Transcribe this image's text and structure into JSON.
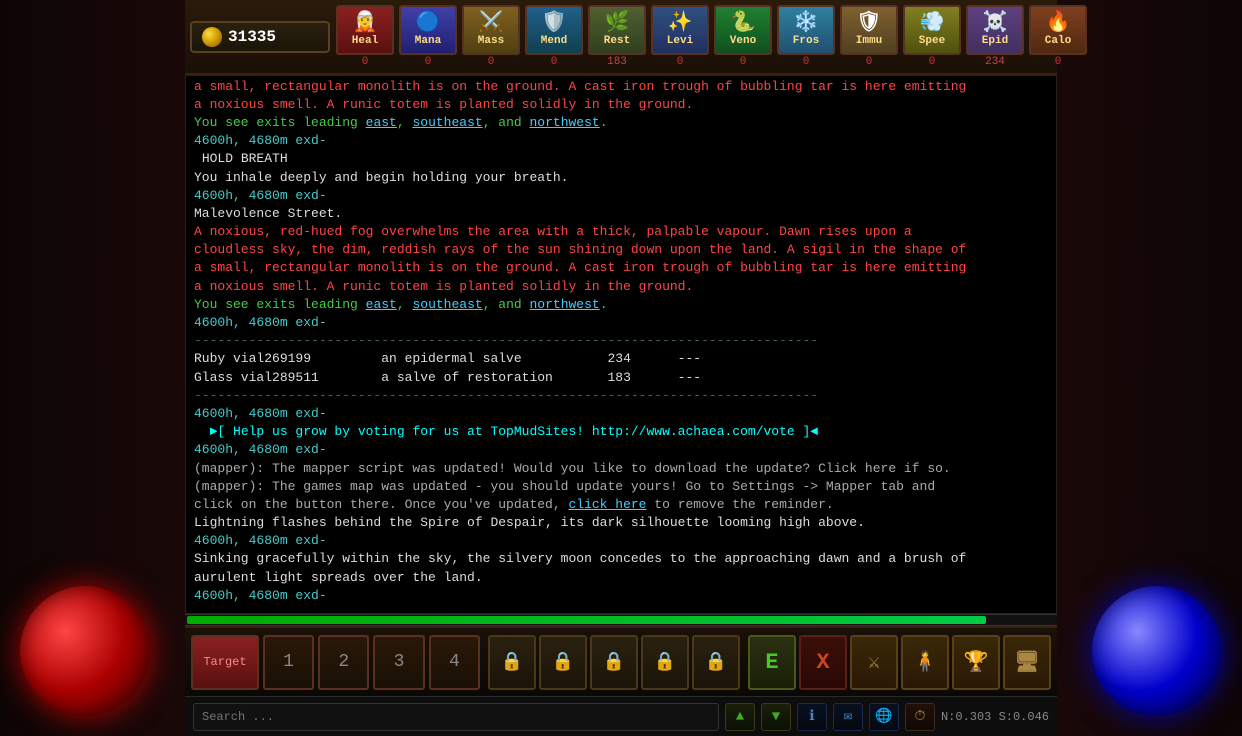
{
  "gold": {
    "amount": "31335",
    "icon": "💰"
  },
  "skills": [
    {
      "id": "heal",
      "label": "Heal",
      "count": "0",
      "css": "heal",
      "figure": "🧝"
    },
    {
      "id": "mana",
      "label": "Mana",
      "count": "0",
      "css": "mana",
      "figure": "🔵"
    },
    {
      "id": "mass",
      "label": "Mass",
      "count": "0",
      "css": "mass",
      "figure": "⚔️"
    },
    {
      "id": "mend",
      "label": "Mend",
      "count": "0",
      "css": "mend",
      "figure": "🛡️"
    },
    {
      "id": "rest",
      "label": "Rest",
      "count": "183",
      "css": "rest",
      "figure": "🌿"
    },
    {
      "id": "levi",
      "label": "Levi",
      "count": "0",
      "css": "levi",
      "figure": "✨"
    },
    {
      "id": "veno",
      "label": "Veno",
      "count": "0",
      "css": "veno",
      "figure": "🐍"
    },
    {
      "id": "fros",
      "label": "Fros",
      "count": "0",
      "css": "fros",
      "figure": "❄️"
    },
    {
      "id": "immu",
      "label": "Immu",
      "count": "0",
      "css": "immu",
      "figure": "🛡"
    },
    {
      "id": "spee",
      "label": "Spee",
      "count": "0",
      "css": "spee",
      "figure": "💨"
    },
    {
      "id": "epid",
      "label": "Epid",
      "count": "234",
      "css": "epid",
      "figure": "☠️"
    },
    {
      "id": "calo",
      "label": "Calo",
      "count": "0",
      "css": "calo",
      "figure": "🔥"
    }
  ],
  "terminal": {
    "lines": [
      {
        "text": "Malevolence Street.",
        "style": "white"
      },
      {
        "text": "A noxious, red-hued fog overwhelms the area with a thick, palpable vapour. Dawn rises upon a",
        "style": "red"
      },
      {
        "text": "cloudless sky, the dim, reddish rays of the sun shining down upon the land. A sigil in the shape of",
        "style": "red"
      },
      {
        "text": "a small, rectangular monolith is on the ground. A cast iron trough of bubbling tar is here emitting",
        "style": "red"
      },
      {
        "text": "a noxious smell. A runic totem is planted solidly in the ground.",
        "style": "red"
      },
      {
        "text": "You see exits leading east, southeast, and northwest.",
        "style": "green",
        "links": [
          "east",
          "southeast",
          "northwest"
        ]
      },
      {
        "text": "4600h, 4680m exd-",
        "style": "cyan"
      },
      {
        "text": " HOLD BREATH",
        "style": "white"
      },
      {
        "text": "You inhale deeply and begin holding your breath.",
        "style": "white"
      },
      {
        "text": "4600h, 4680m exd-",
        "style": "cyan"
      },
      {
        "text": "Malevolence Street.",
        "style": "white"
      },
      {
        "text": "A noxious, red-hued fog overwhelms the area with a thick, palpable vapour. Dawn rises upon a",
        "style": "red"
      },
      {
        "text": "cloudless sky, the dim, reddish rays of the sun shining down upon the land. A sigil in the shape of",
        "style": "red"
      },
      {
        "text": "a small, rectangular monolith is on the ground. A cast iron trough of bubbling tar is here emitting",
        "style": "red"
      },
      {
        "text": "a noxious smell. A runic totem is planted solidly in the ground.",
        "style": "red"
      },
      {
        "text": "You see exits leading east, southeast, and northwest.",
        "style": "green",
        "links": [
          "east",
          "southeast",
          "northwest"
        ]
      },
      {
        "text": "4600h, 4680m exd-",
        "style": "cyan"
      },
      {
        "text": "--------------------------------------------------------------------------------",
        "style": "divider"
      },
      {
        "text": "Ruby vial269199         an epidermal salve           234      ---",
        "style": "white"
      },
      {
        "text": "Glass vial289511        a salve of restoration       183      ---",
        "style": "white"
      },
      {
        "text": "--------------------------------------------------------------------------------",
        "style": "divider"
      },
      {
        "text": "4600h, 4680m exd-",
        "style": "cyan"
      },
      {
        "text": "  ►[ Help us grow by voting for us at TopMudSites! http://www.achaea.com/vote ]◄",
        "style": "bright-cyan"
      },
      {
        "text": "4600h, 4680m exd-",
        "style": "cyan"
      },
      {
        "text": "(mapper): The mapper script was updated! Would you like to download the update? Click here if so.",
        "style": "mapper"
      },
      {
        "text": "(mapper): The games map was updated - you should update yours! Go to Settings -> Mapper tab and",
        "style": "mapper"
      },
      {
        "text": "click on the button there. Once you've updated, click here to remove the reminder.",
        "style": "mapper",
        "link": "click here"
      },
      {
        "text": "Lightning flashes behind the Spire of Despair, its dark silhouette looming high above.",
        "style": "white"
      },
      {
        "text": "4600h, 4680m exd-",
        "style": "cyan"
      },
      {
        "text": "Sinking gracefully within the sky, the silvery moon concedes to the approaching dawn and a brush of",
        "style": "white"
      },
      {
        "text": "aurulent light spreads over the land.",
        "style": "white"
      },
      {
        "text": "4600h, 4680m exd-",
        "style": "cyan"
      }
    ]
  },
  "progressBar": {
    "percent": 92
  },
  "bottomBar": {
    "targetLabel": "Target",
    "slot1": "1",
    "slot2": "2",
    "slot3": "3",
    "slot4": "4"
  },
  "statusBar": {
    "searchPlaceholder": "Search ...",
    "coords": "N:0.303  S:0.046"
  }
}
